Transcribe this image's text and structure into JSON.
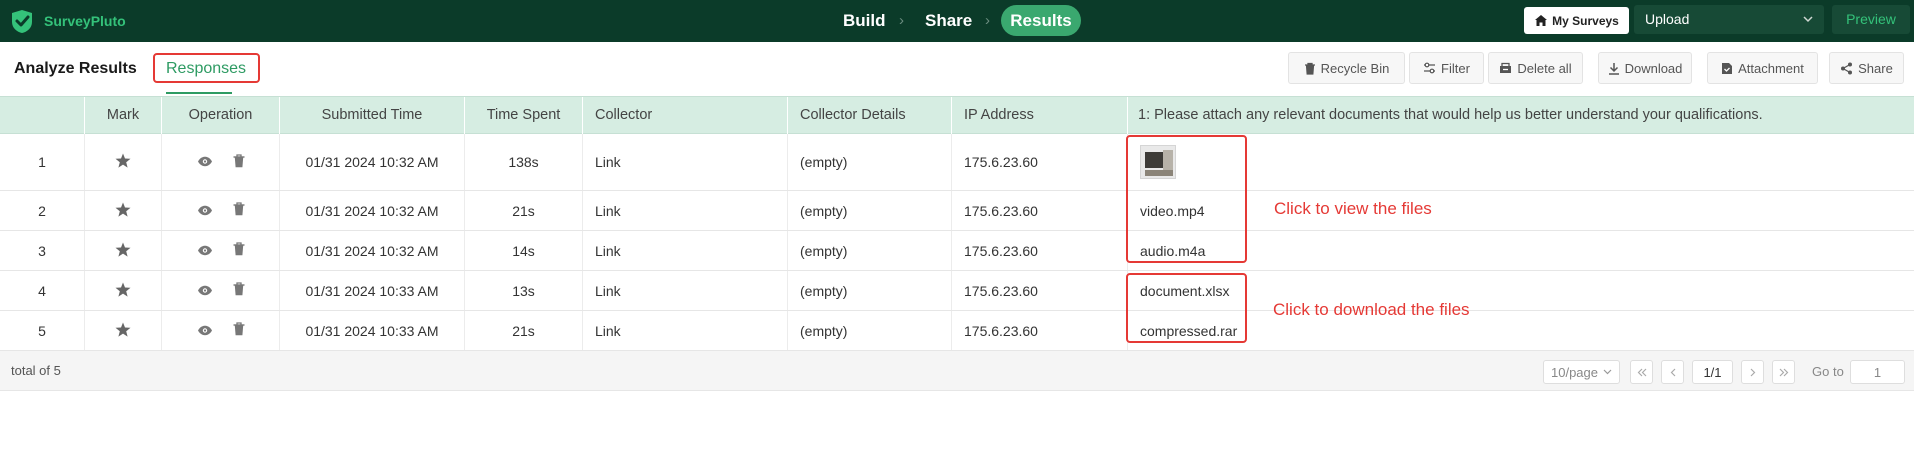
{
  "app": {
    "name": "SurveyPluto",
    "accent": "#2e9b63",
    "topbar_bg": "#0b3b29"
  },
  "steps": {
    "build": "Build",
    "share": "Share",
    "results": "Results",
    "separator": "›"
  },
  "topbar": {
    "my_surveys": "My Surveys",
    "upload_value": "Upload",
    "preview": "Preview"
  },
  "tabs": {
    "analyze": "Analyze Results",
    "responses": "Responses"
  },
  "toolbar": {
    "recycle_bin": "Recycle Bin",
    "filter": "Filter",
    "delete_all": "Delete all",
    "download": "Download",
    "attachment": "Attachment",
    "share": "Share"
  },
  "table": {
    "columns": {
      "index": "",
      "mark": "Mark",
      "operation": "Operation",
      "submitted": "Submitted Time",
      "time_spent": "Time Spent",
      "collector": "Collector",
      "collector_details": "Collector Details",
      "ip": "IP Address",
      "q1": "1: Please attach any relevant documents that would help us better understand your qualifications."
    },
    "rows": [
      {
        "index": "1",
        "submitted": "01/31 2024 10:32 AM",
        "time_spent": "138s",
        "collector": "Link",
        "collector_details": "(empty)",
        "ip": "175.6.23.60",
        "file": "",
        "file_type": "image"
      },
      {
        "index": "2",
        "submitted": "01/31 2024 10:32 AM",
        "time_spent": "21s",
        "collector": "Link",
        "collector_details": "(empty)",
        "ip": "175.6.23.60",
        "file": "video.mp4"
      },
      {
        "index": "3",
        "submitted": "01/31 2024 10:32 AM",
        "time_spent": "14s",
        "collector": "Link",
        "collector_details": "(empty)",
        "ip": "175.6.23.60",
        "file": "audio.m4a"
      },
      {
        "index": "4",
        "submitted": "01/31 2024 10:33 AM",
        "time_spent": "13s",
        "collector": "Link",
        "collector_details": "(empty)",
        "ip": "175.6.23.60",
        "file": "document.xlsx"
      },
      {
        "index": "5",
        "submitted": "01/31 2024 10:33 AM",
        "time_spent": "21s",
        "collector": "Link",
        "collector_details": "(empty)",
        "ip": "175.6.23.60",
        "file": "compressed.rar"
      }
    ]
  },
  "annotations": {
    "view": "Click to view the files",
    "download": "Click to download the files",
    "color": "#e53935"
  },
  "footer": {
    "total": "total of 5",
    "page_size": "10/page",
    "page": "1/1",
    "goto_label": "Go to",
    "goto_value": "1"
  }
}
